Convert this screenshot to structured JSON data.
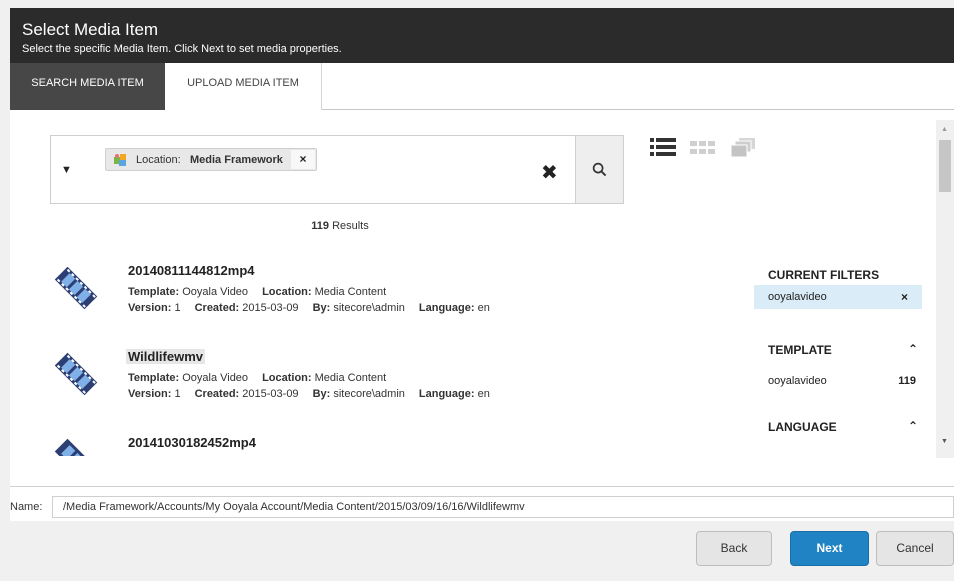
{
  "header": {
    "title": "Select Media Item",
    "subtitle": "Select the specific Media Item. Click Next to set media properties."
  },
  "tabs": [
    {
      "label": "SEARCH MEDIA ITEM",
      "active": true
    },
    {
      "label": "UPLOAD MEDIA ITEM",
      "active": false
    }
  ],
  "search": {
    "chip": {
      "key": "Location:",
      "value": "Media Framework",
      "remove": "×"
    },
    "clear": "✖",
    "dropdown_glyph": "▼"
  },
  "results": {
    "count": "119",
    "label": "Results"
  },
  "items": [
    {
      "name": "20140811144812mp4",
      "template_label": "Template:",
      "template": "Ooyala Video",
      "location_label": "Location:",
      "location": "Media Content",
      "version_label": "Version:",
      "version": "1",
      "created_label": "Created:",
      "created": "2015-03-09",
      "by_label": "By:",
      "by": "sitecore\\admin",
      "language_label": "Language:",
      "language": "en",
      "selected": false
    },
    {
      "name": "Wildlifewmv",
      "template_label": "Template:",
      "template": "Ooyala Video",
      "location_label": "Location:",
      "location": "Media Content",
      "version_label": "Version:",
      "version": "1",
      "created_label": "Created:",
      "created": "2015-03-09",
      "by_label": "By:",
      "by": "sitecore\\admin",
      "language_label": "Language:",
      "language": "en",
      "selected": true
    },
    {
      "name": "20141030182452mp4",
      "selected": false
    }
  ],
  "filters": {
    "current_title": "CURRENT FILTERS",
    "current": [
      {
        "value": "ooyalavideo",
        "remove": "×"
      }
    ],
    "facets": [
      {
        "title": "TEMPLATE",
        "rows": [
          {
            "value": "ooyalavideo",
            "count": "119"
          }
        ]
      },
      {
        "title": "LANGUAGE",
        "rows": []
      }
    ]
  },
  "name_field": {
    "label": "Name:",
    "value": "/Media Framework/Accounts/My Ooyala Account/Media Content/2015/03/09/16/16/Wildlifewmv"
  },
  "buttons": {
    "back": "Back",
    "next": "Next",
    "cancel": "Cancel"
  },
  "colors": {
    "header_bg": "#2b2b2b",
    "active_tab_bg": "#474747",
    "primary_button": "#1f83c4",
    "filter_highlight": "#d9ecf7"
  },
  "icons": [
    "dropdown-arrow-icon",
    "location-puzzle-icon",
    "remove-chip-icon",
    "clear-search-icon",
    "search-icon",
    "list-view-icon",
    "grid-view-icon",
    "stack-view-icon",
    "video-film-icon",
    "remove-filter-icon",
    "chevron-up-icon",
    "scroll-up-icon",
    "scroll-down-icon"
  ]
}
